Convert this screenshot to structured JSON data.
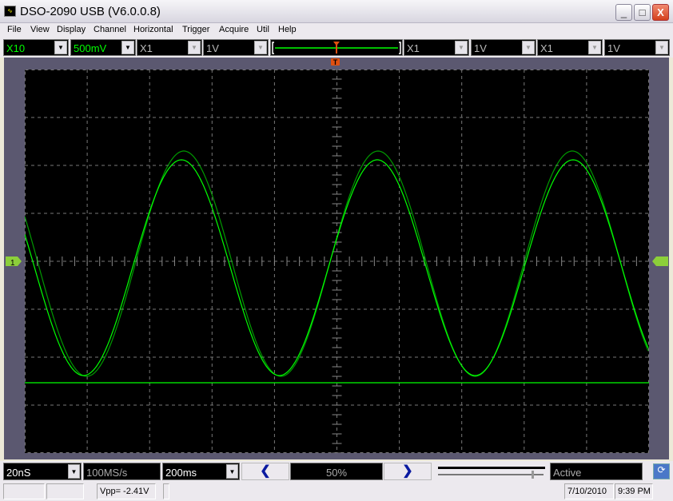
{
  "window": {
    "title": "DSO-2090 USB (V6.0.0.8)",
    "minimize": "_",
    "maximize": "□",
    "close": "X"
  },
  "menu": [
    "File",
    "View",
    "Display",
    "Channel",
    "Horizontal",
    "Trigger",
    "Acquire",
    "Util",
    "Help"
  ],
  "channels": [
    {
      "probe": "X10",
      "volts": "500mV",
      "active": true
    },
    {
      "probe": "X1",
      "volts": "1V",
      "active": false
    },
    {
      "probe": "X1",
      "volts": "1V",
      "active": false
    },
    {
      "probe": "X1",
      "volts": "1V",
      "active": false
    }
  ],
  "markers": {
    "channel1": "1"
  },
  "bottom": {
    "timebase": "20nS",
    "sample_rate": "100MS/s",
    "interval": "200ms",
    "position": "50%",
    "state": "Active"
  },
  "status": {
    "measurement": "Vpp= -2.41V",
    "date": "7/10/2010",
    "time": "9:39 PM"
  },
  "colors": {
    "trace": "#00ff00",
    "screen": "#000000",
    "frame": "#5b5870",
    "trigger": "#e05010"
  }
}
